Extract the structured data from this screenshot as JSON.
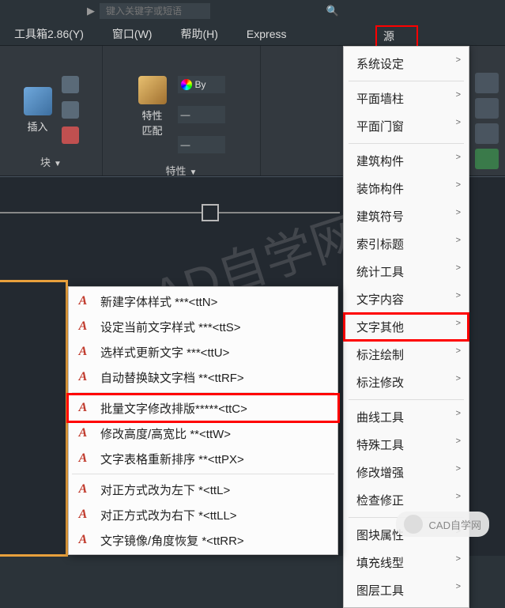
{
  "topbar": {
    "search_placeholder": "键入关键字或短语"
  },
  "menubar": {
    "toolbox": "工具箱2.86(Y)",
    "window": "窗口(W)",
    "help": "帮助(H)",
    "express": "Express",
    "source": "源"
  },
  "ribbon": {
    "insert_label": "插入",
    "block_panel": "块",
    "match_label": "特性\n匹配",
    "props_panel": "特性",
    "bylayer": "By"
  },
  "main_menu": {
    "items": [
      {
        "label": "系统设定",
        "sep_after": true
      },
      {
        "label": "平面墙柱"
      },
      {
        "label": "平面门窗",
        "sep_after": true
      },
      {
        "label": "建筑构件"
      },
      {
        "label": "装饰构件"
      },
      {
        "label": "建筑符号"
      },
      {
        "label": "索引标题"
      },
      {
        "label": "统计工具"
      },
      {
        "label": "文字内容"
      },
      {
        "label": "文字其他",
        "highlight": true
      },
      {
        "label": "标注绘制"
      },
      {
        "label": "标注修改",
        "sep_after": true
      },
      {
        "label": "曲线工具"
      },
      {
        "label": "特殊工具"
      },
      {
        "label": "修改增强"
      },
      {
        "label": "检查修正",
        "sep_after": true
      },
      {
        "label": "图块属性"
      },
      {
        "label": "填充线型"
      },
      {
        "label": "图层工具"
      }
    ]
  },
  "submenu": {
    "items": [
      {
        "icon": "A",
        "label": "新建字体样式    ***<ttN>"
      },
      {
        "icon": "A",
        "label": "设定当前文字样式 ***<ttS>"
      },
      {
        "icon": "A",
        "label": "选样式更新文字   ***<ttU>"
      },
      {
        "icon": "A",
        "label": "自动替换缺文字档  **<ttRF>",
        "sep_after": true
      },
      {
        "icon": "A",
        "label": "批量文字修改排版*****<ttC>",
        "highlight": true
      },
      {
        "icon": "A",
        "label": "修改高度/高宽比    **<ttW>"
      },
      {
        "icon": "A",
        "label": "文字表格重新排序   **<ttPX>",
        "sep_after": true
      },
      {
        "icon": "A",
        "label": "对正方式改为左下  *<ttL>"
      },
      {
        "icon": "A",
        "label": "对正方式改为右下  *<ttLL>"
      },
      {
        "icon": "A",
        "label": "文字镜像/角度恢复  *<ttRR>"
      }
    ]
  },
  "watermark": "CAD自学网 cadzxw",
  "footer": "CAD自学网"
}
